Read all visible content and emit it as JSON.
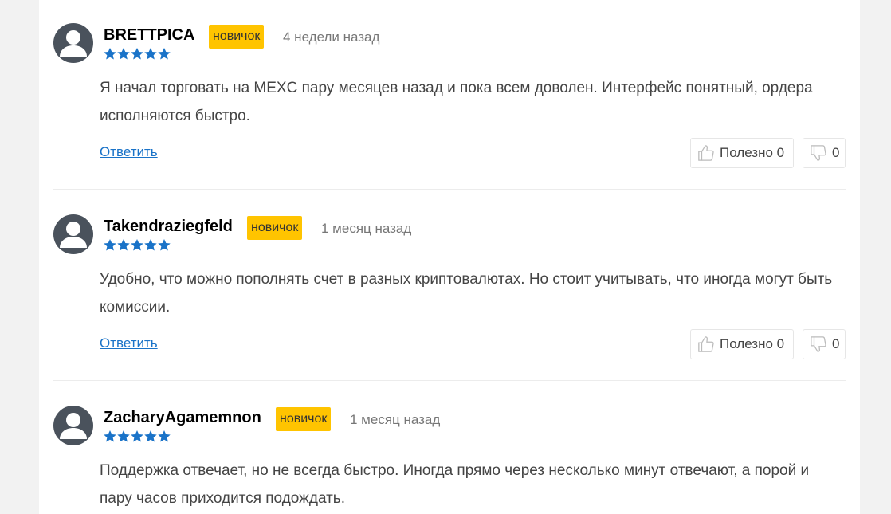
{
  "reviews": [
    {
      "author": "BRETTPICA",
      "badge": "новичок",
      "time": "4 недели назад",
      "rating": 5,
      "text": "Я начал торговать на MEXC пару месяцев назад и пока всем доволен. Интерфейс понятный, ордера исполняются быстро.",
      "reply_label": "Ответить",
      "useful_label": "Полезно 0",
      "dislike_count": "0"
    },
    {
      "author": "Takendraziegfeld",
      "badge": "новичок",
      "time": "1 месяц назад",
      "rating": 5,
      "text": "Удобно, что можно пополнять счет в разных криптовалютах. Но стоит учитывать, что иногда могут быть комиссии.",
      "reply_label": "Ответить",
      "useful_label": "Полезно 0",
      "dislike_count": "0"
    },
    {
      "author": "ZacharyAgamemnon",
      "badge": "новичок",
      "time": "1 месяц назад",
      "rating": 5,
      "text": "Поддержка отвечает, но не всегда быстро. Иногда прямо через несколько минут отвечают, а порой и пару часов приходится подождать.",
      "reply_label": "Ответить",
      "useful_label": "Полезно 0",
      "dislike_count": "0"
    }
  ],
  "colors": {
    "badge": "#ffc400",
    "star": "#1a73c8",
    "link": "#1a73c8",
    "avatar": "#4a525c"
  },
  "icons": {
    "avatar": "user-avatar-icon",
    "star": "star-icon",
    "like": "thumbs-up-icon",
    "dislike": "thumbs-down-icon"
  }
}
